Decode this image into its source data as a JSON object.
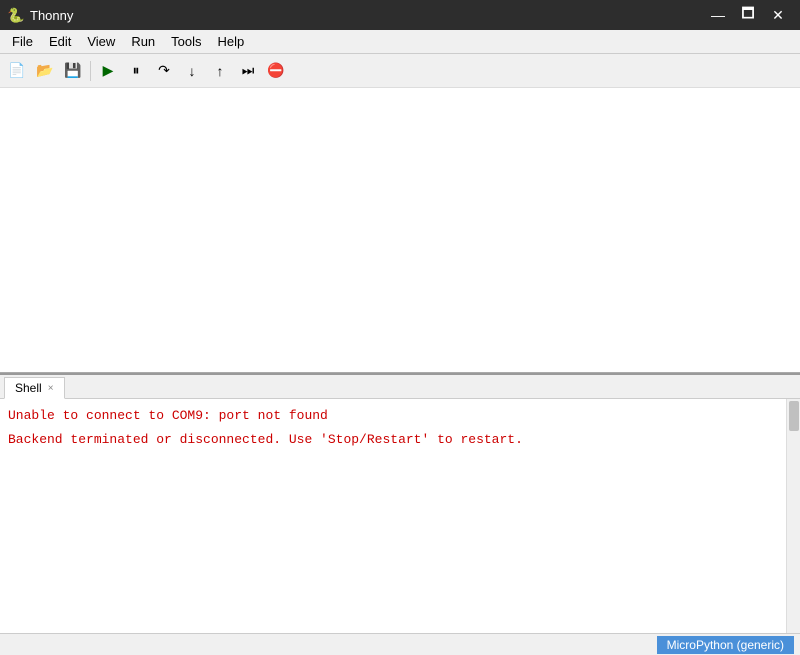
{
  "titlebar": {
    "icon": "🐍",
    "title": "Thonny",
    "minimize_label": "—",
    "maximize_label": "🗖",
    "close_label": "✕"
  },
  "menubar": {
    "items": [
      "File",
      "Edit",
      "View",
      "Run",
      "Tools",
      "Help"
    ]
  },
  "toolbar": {
    "buttons": [
      {
        "name": "new",
        "icon": "📄"
      },
      {
        "name": "open",
        "icon": "📂"
      },
      {
        "name": "save",
        "icon": "💾"
      },
      {
        "name": "run",
        "icon": "▶"
      },
      {
        "name": "debug",
        "icon": "🐛"
      },
      {
        "name": "step-over",
        "icon": "↷"
      },
      {
        "name": "step-into",
        "icon": "↓"
      },
      {
        "name": "step-out",
        "icon": "↑"
      },
      {
        "name": "resume",
        "icon": "⏭"
      },
      {
        "name": "stop",
        "icon": "⛔"
      }
    ]
  },
  "shell": {
    "tab_label": "Shell",
    "tab_close": "×",
    "messages": [
      "Unable to connect to COM9: port not found",
      "Backend terminated or disconnected. Use 'Stop/Restart' to restart."
    ]
  },
  "statusbar": {
    "interpreter_label": "MicroPython (generic)"
  }
}
